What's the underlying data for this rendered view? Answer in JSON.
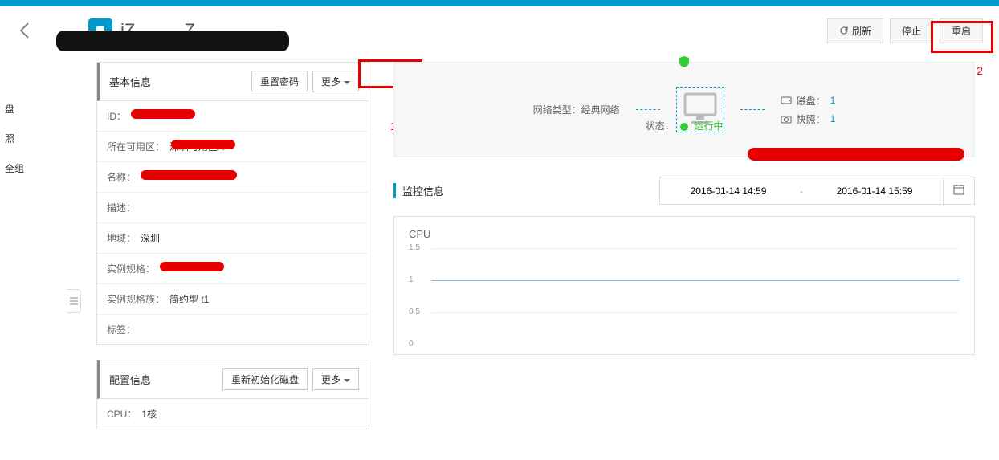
{
  "header": {
    "title": "iZ..........Z",
    "refresh": "刷新",
    "stop": "停止",
    "restart": "重启"
  },
  "annotations": {
    "one": "1",
    "two": "2"
  },
  "sidebar": {
    "items": [
      {
        "label": "盘"
      },
      {
        "label": "照"
      },
      {
        "label": "全组"
      }
    ]
  },
  "basic_info": {
    "title": "基本信息",
    "reset_pwd": "重置密码",
    "more": "更多",
    "rows": {
      "id": "ID：",
      "zone_label": "所在可用区：",
      "zone_value": "深圳可用区A",
      "name": "名称：",
      "desc": "描述：",
      "region_label": "地域：",
      "region_value": "深圳",
      "spec": "实例规格：",
      "spec_family_label": "实例规格族：",
      "spec_family_value": "简约型 t1",
      "tags": "标签："
    }
  },
  "config_info": {
    "title": "配置信息",
    "reinit": "重新初始化磁盘",
    "more": "更多",
    "cpu_label": "CPU：",
    "cpu_value": "1核"
  },
  "status_area": {
    "net_type_label": "网络类型：",
    "net_type_value": "经典网络",
    "disk_label": "磁盘：",
    "disk_count": "1",
    "snap_label": "快照：",
    "snap_count": "1",
    "status_label": "状态：",
    "status_value": "运行中"
  },
  "monitor": {
    "title": "监控信息",
    "date_from": "2016-01-14 14:59",
    "date_to": "2016-01-14 15:59"
  },
  "chart_data": {
    "type": "line",
    "title": "CPU",
    "xlabel": "",
    "ylabel": "",
    "ylim": [
      0,
      1.5
    ],
    "y_ticks": [
      0,
      0.5,
      1,
      1.5
    ],
    "x": [],
    "series": [
      {
        "name": "CPU",
        "values": []
      }
    ]
  }
}
